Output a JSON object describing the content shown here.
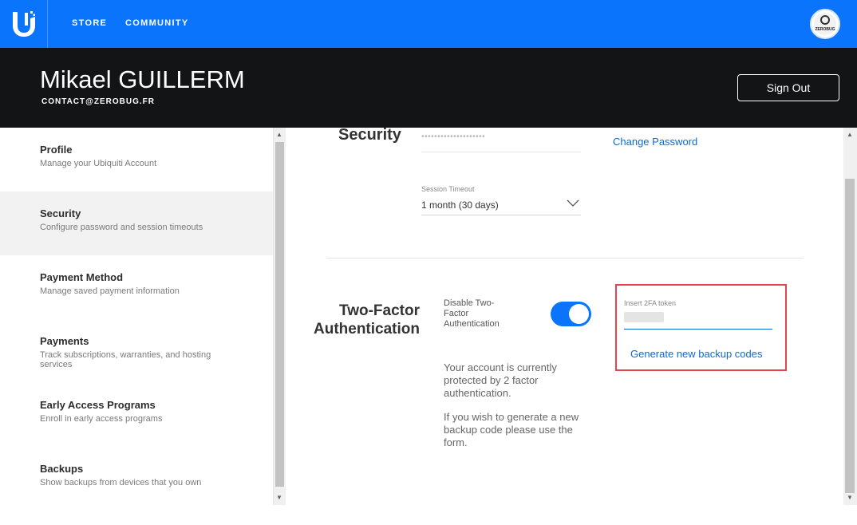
{
  "nav": {
    "logo_icon": "ubiquiti-u-logo",
    "links": [
      "STORE",
      "COMMUNITY"
    ],
    "avatar_text": "ZEROBUG",
    "brand_color": "#0a74fc"
  },
  "header": {
    "name": "Mikael GUILLERM",
    "email": "CONTACT@ZEROBUG.FR",
    "sign_out_label": "Sign Out"
  },
  "sidebar": {
    "items": [
      {
        "title": "Profile",
        "desc": "Manage your Ubiquiti Account",
        "active": false
      },
      {
        "title": "Security",
        "desc": "Configure password and session timeouts",
        "active": true
      },
      {
        "title": "Payment Method",
        "desc": "Manage saved payment information",
        "active": false
      },
      {
        "title": "Payments",
        "desc": "Track subscriptions, warranties, and hosting services",
        "active": false
      },
      {
        "title": "Early Access Programs",
        "desc": "Enroll in early access programs",
        "active": false
      },
      {
        "title": "Backups",
        "desc": "Show backups from devices that you own",
        "active": false
      }
    ]
  },
  "security": {
    "heading": "Security",
    "password_mask": "••••••••••••••••••••",
    "change_password_label": "Change Password",
    "session_timeout_label": "Session Timeout",
    "session_timeout_value": "1 month (30 days)"
  },
  "two_factor": {
    "heading_line1": "Two-Factor",
    "heading_line2": "Authentication",
    "toggle_label": "Disable Two-Factor Authentication",
    "toggle_on": true,
    "message1": "Your account is currently protected by 2 factor authentication.",
    "message2": "If you wish to generate a new backup code please use the form.",
    "token_label": "Insert 2FA token",
    "generate_label": "Generate new backup codes",
    "highlight_color": "#e0474c"
  }
}
